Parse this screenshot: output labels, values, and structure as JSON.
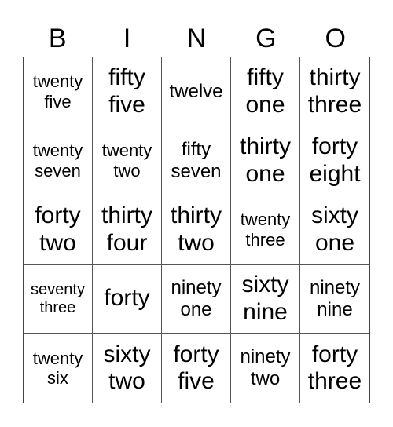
{
  "header": [
    "B",
    "I",
    "N",
    "G",
    "O"
  ],
  "cells": [
    {
      "text": "twenty\nfive",
      "size": "s1"
    },
    {
      "text": "fifty\nfive",
      "size": "s2"
    },
    {
      "text": "twelve",
      "size": "s4"
    },
    {
      "text": "fifty\none",
      "size": "s2"
    },
    {
      "text": "thirty\nthree",
      "size": "s2"
    },
    {
      "text": "twenty\nseven",
      "size": "s1"
    },
    {
      "text": "twenty\ntwo",
      "size": "s1"
    },
    {
      "text": "fifty\nseven",
      "size": "s4"
    },
    {
      "text": "thirty\none",
      "size": "s2"
    },
    {
      "text": "forty\neight",
      "size": "s2"
    },
    {
      "text": "forty\ntwo",
      "size": "s2"
    },
    {
      "text": "thirty\nfour",
      "size": "s2"
    },
    {
      "text": "thirty\ntwo",
      "size": "s2"
    },
    {
      "text": "twenty\nthree",
      "size": "s1"
    },
    {
      "text": "sixty\none",
      "size": "s2"
    },
    {
      "text": "seventy\nthree",
      "size": "s3"
    },
    {
      "text": "forty",
      "size": "s2"
    },
    {
      "text": "ninety\none",
      "size": "s4"
    },
    {
      "text": "sixty\nnine",
      "size": "s2"
    },
    {
      "text": "ninety\nnine",
      "size": "s4"
    },
    {
      "text": "twenty\nsix",
      "size": "s1"
    },
    {
      "text": "sixty\ntwo",
      "size": "s2"
    },
    {
      "text": "forty\nfive",
      "size": "s2"
    },
    {
      "text": "ninety\ntwo",
      "size": "s4"
    },
    {
      "text": "forty\nthree",
      "size": "s2"
    }
  ]
}
